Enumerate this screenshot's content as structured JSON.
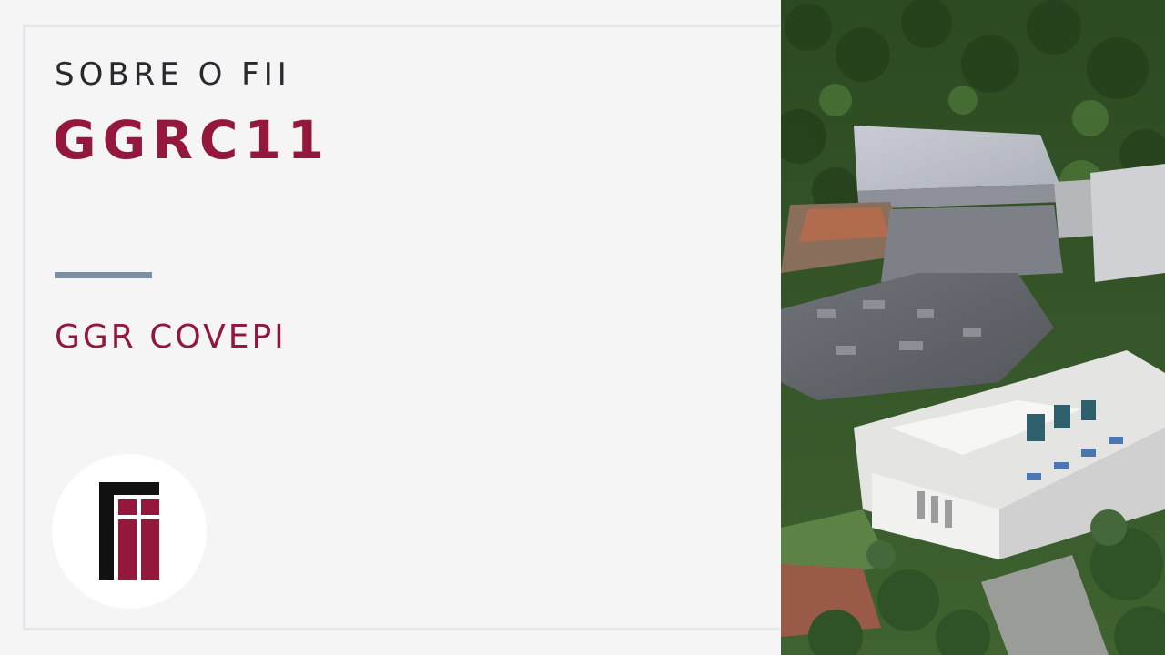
{
  "card": {
    "eyebrow": "SOBRE O FII",
    "ticker": "GGRC11",
    "fund_name": "GGR COVEPI"
  },
  "logo": {
    "icon": "fii-logo-icon",
    "alt": "FII"
  },
  "photo": {
    "subject": "aerial-photo-industrial-buildings"
  },
  "colors": {
    "background": "#f5f5f6",
    "frame": "#e6e6ea",
    "brand": "#93183c",
    "divider": "#7b8ea4",
    "text": "#2a2a2e"
  }
}
